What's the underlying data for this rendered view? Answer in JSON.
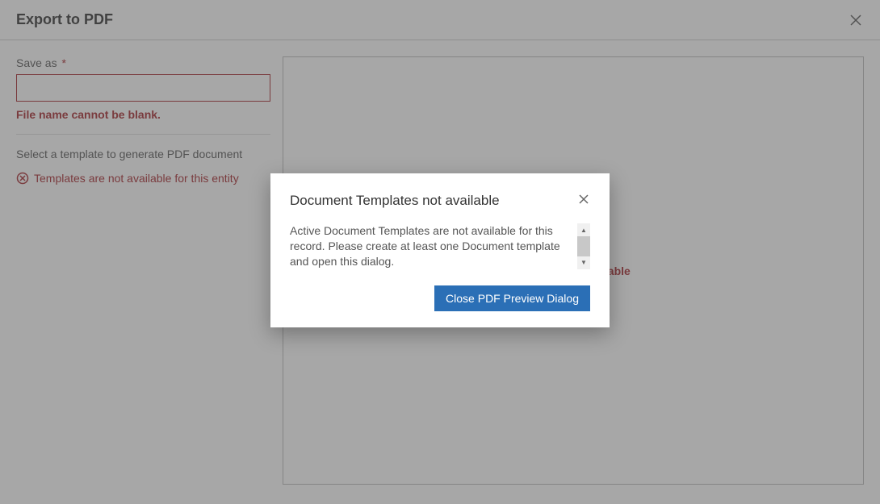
{
  "header": {
    "title": "Export to PDF"
  },
  "form": {
    "save_as_label": "Save as",
    "filename_value": "",
    "filename_error": "File name cannot be blank.",
    "template_hint": "Select a template to generate PDF document",
    "template_error": "Templates are not available for this entity"
  },
  "preview": {
    "placeholder": "Preview not available"
  },
  "modal": {
    "title": "Document Templates not available",
    "body": "Active Document Templates are not available for this record. Please create at least one Document template and open this dialog.",
    "close_button": "Close PDF Preview Dialog"
  },
  "colors": {
    "error": "#a4262c",
    "primary_button": "#2b6fb6"
  }
}
